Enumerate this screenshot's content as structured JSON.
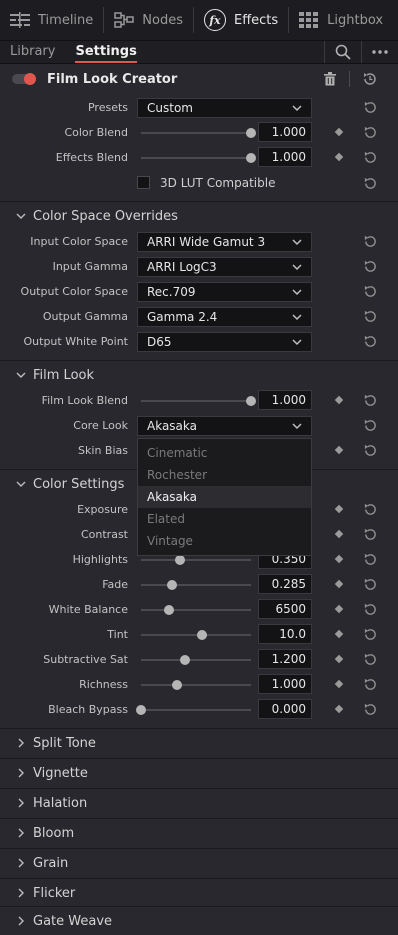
{
  "nav": {
    "timeline": "Timeline",
    "nodes": "Nodes",
    "effects": "Effects",
    "lightbox": "Lightbox",
    "fx_glyph": "fx"
  },
  "subtabs": {
    "library": "Library",
    "settings": "Settings"
  },
  "effect": {
    "title": "Film Look Creator",
    "enabled": true
  },
  "general": {
    "presets": {
      "label": "Presets",
      "value": "Custom"
    },
    "color_blend": {
      "label": "Color Blend",
      "value": "1.000",
      "level": 1.0
    },
    "effects_blend": {
      "label": "Effects Blend",
      "value": "1.000",
      "level": 1.0
    },
    "lut_compatible": {
      "label": "3D LUT Compatible",
      "checked": false
    }
  },
  "color_space": {
    "title": "Color Space Overrides",
    "input_color_space": {
      "label": "Input Color Space",
      "value": "ARRI Wide Gamut 3"
    },
    "input_gamma": {
      "label": "Input Gamma",
      "value": "ARRI LogC3"
    },
    "output_color_space": {
      "label": "Output Color Space",
      "value": "Rec.709"
    },
    "output_gamma": {
      "label": "Output Gamma",
      "value": "Gamma 2.4"
    },
    "output_white_point": {
      "label": "Output White Point",
      "value": "D65"
    }
  },
  "film_look": {
    "title": "Film Look",
    "blend": {
      "label": "Film Look Blend",
      "value": "1.000",
      "level": 1.0
    },
    "core_look": {
      "label": "Core Look",
      "value": "Akasaka"
    },
    "skin_bias": {
      "label": "Skin Bias"
    },
    "core_look_options": [
      "Cinematic",
      "Rochester",
      "Akasaka",
      "Elated",
      "Vintage"
    ],
    "selected_option_index": 2
  },
  "color_settings": {
    "title": "Color Settings",
    "exposure": {
      "label": "Exposure"
    },
    "contrast": {
      "label": "Contrast"
    },
    "highlights": {
      "label": "Highlights",
      "value": "0.350",
      "level": 0.35
    },
    "fade": {
      "label": "Fade",
      "value": "0.285",
      "level": 0.285
    },
    "white_balance": {
      "label": "White Balance",
      "value": "6500",
      "level": 0.25
    },
    "tint": {
      "label": "Tint",
      "value": "10.0",
      "level": 0.55
    },
    "subtractive_sat": {
      "label": "Subtractive Sat",
      "value": "1.200",
      "level": 0.4
    },
    "richness": {
      "label": "Richness",
      "value": "1.000",
      "level": 0.33
    },
    "bleach_bypass": {
      "label": "Bleach Bypass",
      "value": "0.000",
      "level": 0.0
    }
  },
  "collapsed_sections": [
    "Split Tone",
    "Vignette",
    "Halation",
    "Bloom",
    "Grain",
    "Flicker",
    "Gate Weave"
  ],
  "colors": {
    "accent": "#e0574f",
    "panel": "#28282e",
    "field": "#131316"
  }
}
